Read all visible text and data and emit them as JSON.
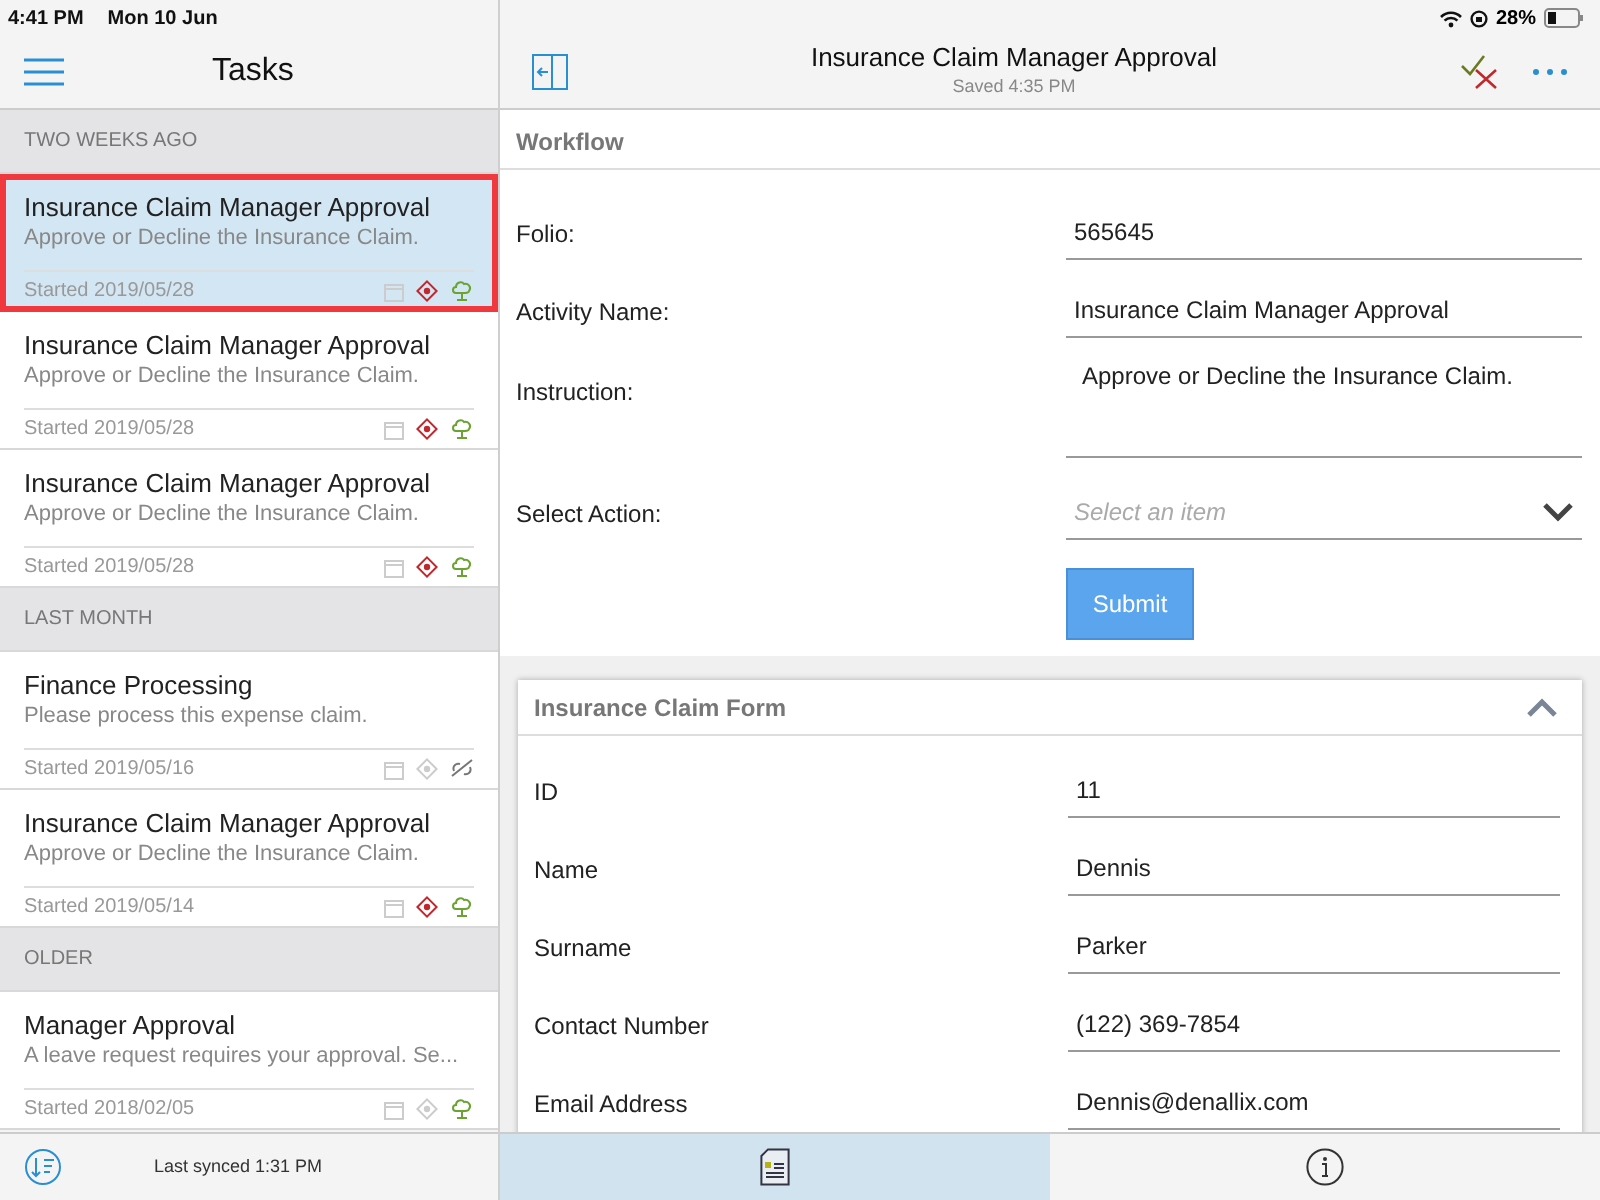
{
  "status_bar": {
    "time": "4:41 PM",
    "date": "Mon 10 Jun",
    "battery": "28%"
  },
  "sidebar": {
    "title": "Tasks",
    "groups": [
      {
        "heading": "TWO WEEKS AGO",
        "items": [
          {
            "title": "Insurance Claim Manager Approval",
            "subtitle": "Approve or Decline the Insurance Claim.",
            "started": "Started 2019/05/28",
            "selected": true,
            "priority": true,
            "synced": true
          },
          {
            "title": "Insurance Claim Manager Approval",
            "subtitle": "Approve or Decline the Insurance Claim.",
            "started": "Started 2019/05/28",
            "selected": false,
            "priority": true,
            "synced": true
          },
          {
            "title": "Insurance Claim Manager Approval",
            "subtitle": "Approve or Decline the Insurance Claim.",
            "started": "Started 2019/05/28",
            "selected": false,
            "priority": true,
            "synced": true
          }
        ]
      },
      {
        "heading": "LAST MONTH",
        "items": [
          {
            "title": "Finance Processing",
            "subtitle": "Please process this expense claim.",
            "started": "Started 2019/05/16",
            "selected": false,
            "priority": false,
            "synced": false
          },
          {
            "title": "Insurance Claim Manager Approval",
            "subtitle": "Approve or Decline the Insurance Claim.",
            "started": "Started 2019/05/14",
            "selected": false,
            "priority": true,
            "synced": true
          }
        ]
      },
      {
        "heading": "OLDER",
        "items": [
          {
            "title": "Manager Approval",
            "subtitle": "A leave request requires your approval. Se...",
            "started": "Started 2018/02/05",
            "selected": false,
            "priority": false,
            "synced": true
          }
        ]
      }
    ],
    "footer": "Last synced 1:31 PM"
  },
  "detail": {
    "title": "Insurance Claim Manager Approval",
    "subtitle": "Saved 4:35 PM",
    "workflow": {
      "heading": "Workflow",
      "fields": [
        {
          "label": "Folio:",
          "value": "565645",
          "kind": "text"
        },
        {
          "label": "Activity Name:",
          "value": "Insurance Claim Manager Approval",
          "kind": "text"
        },
        {
          "label": "Instruction:",
          "value": "Approve or Decline the Insurance Claim.",
          "kind": "multiline"
        },
        {
          "label": "Select Action:",
          "placeholder": "Select an item",
          "kind": "select"
        }
      ],
      "submit": "Submit"
    },
    "form": {
      "heading": "Insurance Claim Form",
      "expanded": true,
      "fields": [
        {
          "label": "ID",
          "value": "11"
        },
        {
          "label": "Name",
          "value": "Dennis"
        },
        {
          "label": "Surname",
          "value": "Parker"
        },
        {
          "label": "Contact Number",
          "value": "(122) 369-7854"
        },
        {
          "label": "Email Address",
          "value": "Dennis@denallix.com"
        }
      ]
    }
  },
  "bottom_tabs": [
    {
      "kind": "document",
      "selected": true
    },
    {
      "kind": "info",
      "selected": false
    }
  ]
}
